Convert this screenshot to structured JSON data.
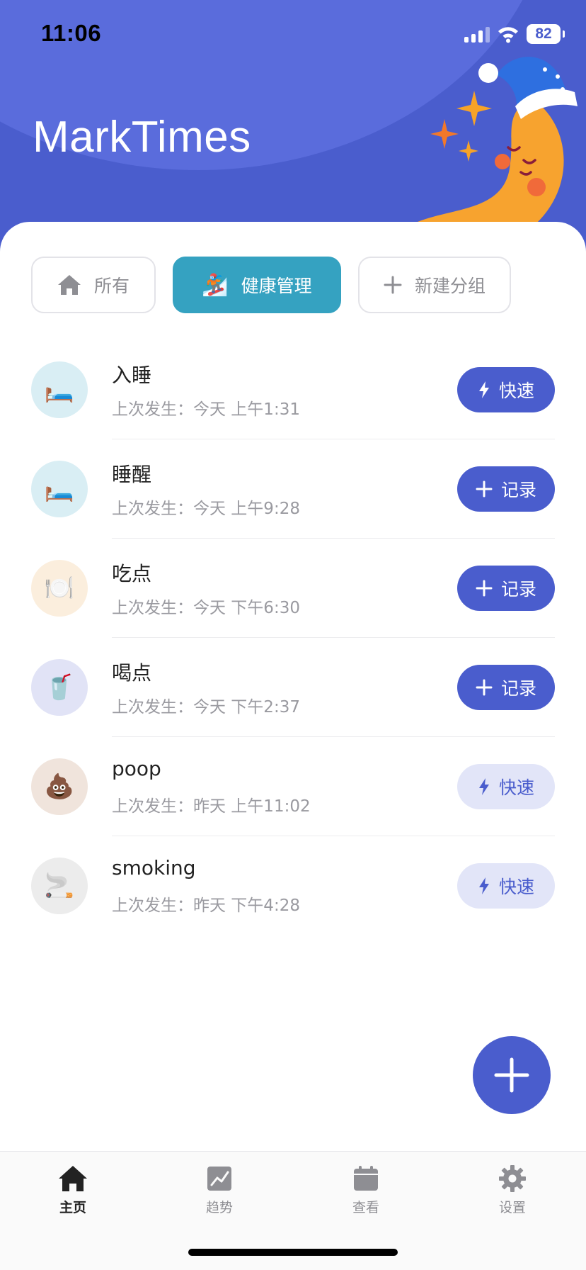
{
  "status_bar": {
    "time": "11:06",
    "battery": "82"
  },
  "app": {
    "title": "MarkTimes"
  },
  "groups": [
    {
      "label": "所有",
      "icon": "home-icon",
      "active": false
    },
    {
      "label": "健康管理",
      "icon": "snowboarder-emoji",
      "emoji": "🏂",
      "active": true
    },
    {
      "label": "新建分组",
      "icon": "plus-icon",
      "active": false
    }
  ],
  "events": [
    {
      "name": "入睡",
      "emoji": "🛏️",
      "last": "上次发生：今天 上午1:31",
      "action": "快速",
      "action_icon": "bolt-icon",
      "style": "primary",
      "avatar_bg": "#d9eef4"
    },
    {
      "name": "睡醒",
      "emoji": "🛏️",
      "last": "上次发生：今天 上午9:28",
      "action": "记录",
      "action_icon": "plus-icon",
      "style": "primary",
      "avatar_bg": "#d9eef4"
    },
    {
      "name": "吃点",
      "emoji": "🍽️",
      "last": "上次发生：今天 下午6:30",
      "action": "记录",
      "action_icon": "plus-icon",
      "style": "primary",
      "avatar_bg": "#fbeedd"
    },
    {
      "name": "喝点",
      "emoji": "🥤",
      "last": "上次发生：今天 下午2:37",
      "action": "记录",
      "action_icon": "plus-icon",
      "style": "primary",
      "avatar_bg": "#e1e3f6"
    },
    {
      "name": "poop",
      "emoji": "💩",
      "last": "上次发生：昨天 上午11:02",
      "action": "快速",
      "action_icon": "bolt-icon",
      "style": "light",
      "avatar_bg": "#f0e4dc"
    },
    {
      "name": "smoking",
      "emoji": "🚬",
      "last": "上次发生：昨天 下午4:28",
      "action": "快速",
      "action_icon": "bolt-icon",
      "style": "light",
      "avatar_bg": "#ececec"
    }
  ],
  "tabs": [
    {
      "label": "主页",
      "icon": "home-icon",
      "active": true
    },
    {
      "label": "趋势",
      "icon": "trend-icon",
      "active": false
    },
    {
      "label": "查看",
      "icon": "calendar-icon",
      "active": false
    },
    {
      "label": "设置",
      "icon": "gear-icon",
      "active": false
    }
  ],
  "colors": {
    "primary": "#4a5dcd",
    "header": "#4a5dcd",
    "chip_active": "#35a2c1",
    "light_button": "#e2e5f8"
  }
}
